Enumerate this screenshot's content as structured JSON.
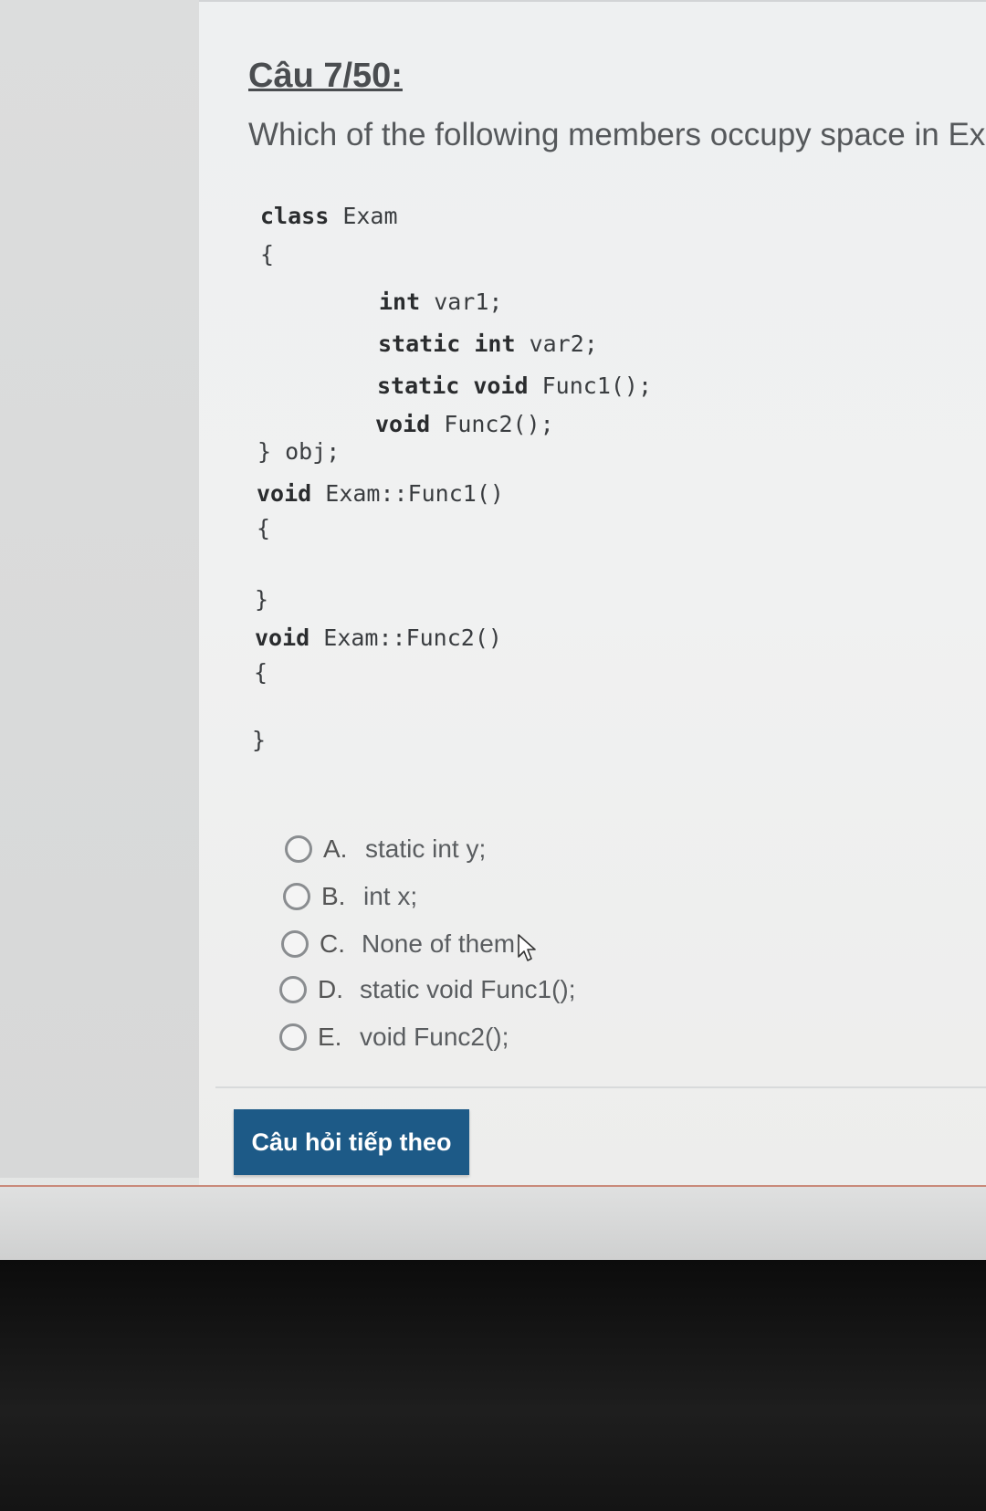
{
  "question": {
    "number": "Câu 7/50:",
    "text": "Which of the following members occupy space in Exar"
  },
  "code": {
    "line1_kw": "class",
    "line1_rest": " Exam",
    "brace_open": "{",
    "member1_kw": "int",
    "member1_rest": " var1;",
    "member2_kw": "static int",
    "member2_rest": " var2;",
    "member3_kw": "static void",
    "member3_rest": " Func1();",
    "member4_kw": "void",
    "member4_rest": " Func2();",
    "class_close": "} obj;",
    "def1_kw": "void",
    "def1_rest": " Exam::Func1()",
    "def1_open": "{",
    "def1_close": "}",
    "def2_kw": "void",
    "def2_rest": " Exam::Func2()",
    "def2_open": "{",
    "def2_close": "}"
  },
  "options": [
    {
      "letter": "A.",
      "text": "static int y;"
    },
    {
      "letter": "B.",
      "text": "int x;"
    },
    {
      "letter": "C.",
      "text": "None of them"
    },
    {
      "letter": "D.",
      "text": "static void Func1();"
    },
    {
      "letter": "E.",
      "text": "void Func2();"
    }
  ],
  "next_button_label": "Câu hỏi tiếp theo",
  "icons": {
    "radio": "radio-icon",
    "cursor": "mouse-cursor-icon"
  }
}
